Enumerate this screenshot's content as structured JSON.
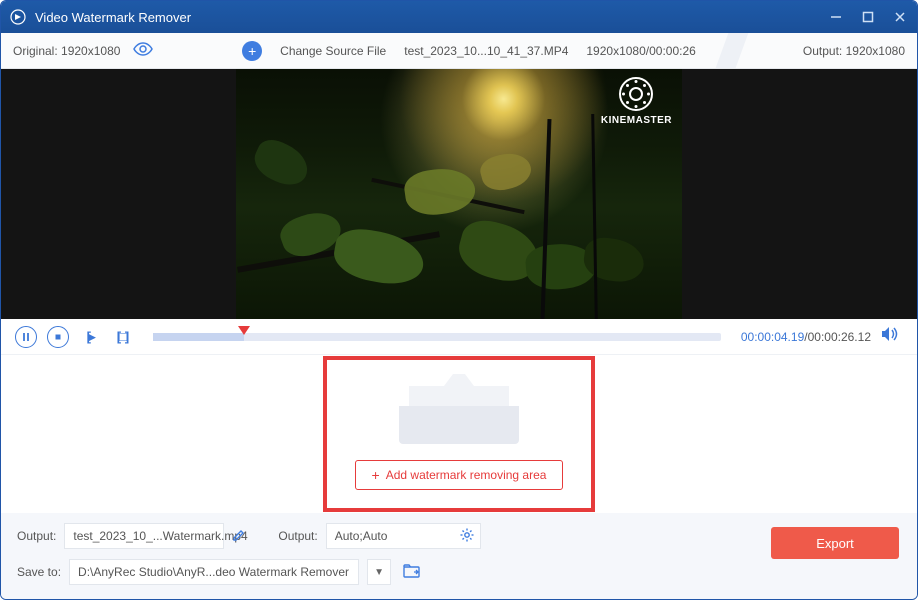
{
  "titlebar": {
    "app_name": "Video Watermark Remover"
  },
  "info": {
    "original_label": "Original:",
    "original_res": "1920x1080",
    "change_source": "Change Source File",
    "filename": "test_2023_10...10_41_37.MP4",
    "meta": "1920x1080/00:00:26",
    "output_label": "Output:",
    "output_res": "1920x1080"
  },
  "watermark_overlay": {
    "text": "KINEMASTER"
  },
  "timeline": {
    "current": "00:00:04.19",
    "total": "00:00:26.12",
    "progress_pct": 16
  },
  "add_area": {
    "button": "Add watermark removing area"
  },
  "bottom": {
    "output_label": "Output:",
    "output_filename": "test_2023_10_...Watermark.mp4",
    "format_label": "Output:",
    "format_value": "Auto;Auto",
    "save_label": "Save to:",
    "save_path": "D:\\AnyRec Studio\\AnyR...deo Watermark Remover",
    "export": "Export"
  }
}
